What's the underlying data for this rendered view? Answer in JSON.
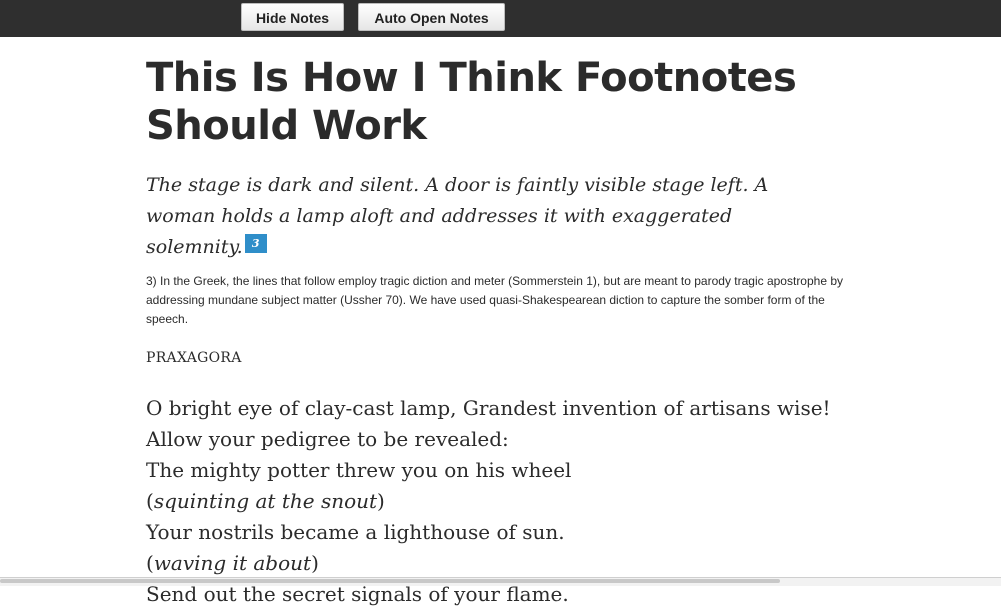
{
  "toolbar": {
    "hide_notes": "Hide Notes",
    "auto_open_notes": "Auto Open Notes"
  },
  "article": {
    "title_line1": "This Is How I Think Footnotes",
    "title_line2": "Should Work",
    "intro": "The stage is dark and silent.  A door is faintly visible stage left.  A woman holds a lamp aloft and addresses it with exaggerated solemnity.",
    "footnote_marker": "3",
    "footnote_text": "3) In the Greek, the lines that follow employ tragic diction and meter (Sommerstein 1), but are meant to parody tragic apostrophe by addressing mundane subject matter (Ussher 70). We have used quasi-Shakespearean diction to capture the somber form of the speech.",
    "speaker": "PRAXAGORA",
    "verse": {
      "l1": "O bright eye of clay-cast lamp,  Grandest invention of artisans wise!",
      "l2": "Allow your pedigree to be revealed:",
      "l3": "The mighty potter threw you on his wheel",
      "l4": "squinting at the snout",
      "l5": "Your nostrils became a lighthouse of sun.",
      "l6": "waving it about",
      "l7": "Send out the secret signals of your flame."
    }
  },
  "colors": {
    "topbar": "#2f2f2f",
    "footnote_marker": "#2f8ec9"
  }
}
